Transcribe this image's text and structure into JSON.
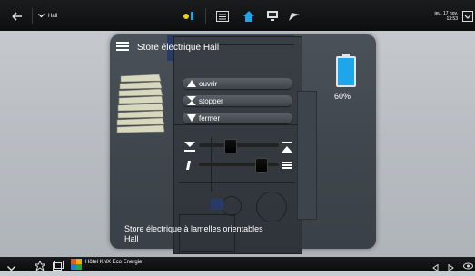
{
  "top_bar": {
    "back_icon": "back-arrow-icon",
    "room_menu_label": "Hall",
    "status_indicator_color": "#e8d21a",
    "clock_date": "jeu. 17 nov.",
    "clock_time": "13:53"
  },
  "panel": {
    "title": "Store électrique Hall",
    "commands": [
      {
        "label": "ouvrir",
        "icon": "triangle-up-icon"
      },
      {
        "label": "stopper",
        "icon": "stop-icon"
      },
      {
        "label": "fermer",
        "icon": "triangle-down-icon"
      }
    ],
    "position_percent": "60%",
    "position_fraction": 0.6,
    "description_line1": "Store électrique à lamelles orientables",
    "description_line2": "Hall"
  },
  "bottom_bar": {
    "project_name": "Hôtel KNX Eco Energie"
  },
  "colors": {
    "accent_blue": "#1fa6ea",
    "bar_background": "#111213",
    "panel_background": "#444b52"
  }
}
